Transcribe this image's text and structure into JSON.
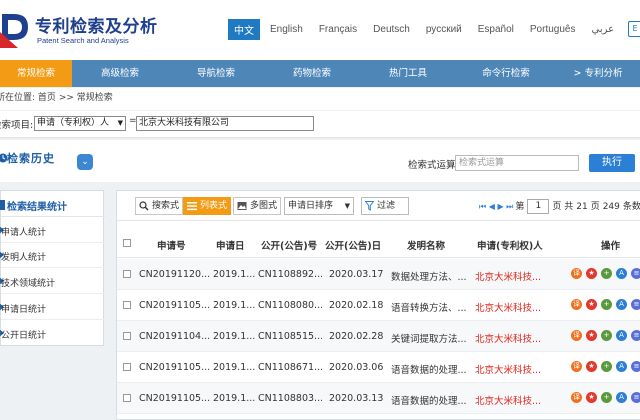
{
  "header": {
    "title": "专利检索及分析",
    "subtitle": "Patent Search and Analysis",
    "languages": [
      "中文",
      "English",
      "Français",
      "Deutsch",
      "русский",
      "Español",
      "Português",
      "عربي"
    ],
    "active_language": "中文",
    "help_glyph": "E"
  },
  "nav": {
    "items": [
      "常规检索",
      "高级检索",
      "导航检索",
      "药物检索",
      "热门工具",
      "命令行检索",
      "> 专利分析"
    ],
    "active": "常规检索"
  },
  "breadcrumb": {
    "prefix": "所在位置:",
    "home": "首页",
    "sep": ">>",
    "current": "常规检索"
  },
  "search": {
    "label": "检索项目:",
    "field": "申请（专利权）人",
    "eq": "=",
    "value": "北京大米科技有限公司"
  },
  "history": {
    "title": "检索历史",
    "op_label": "检索式运算",
    "op_placeholder": "检索式运算",
    "exec_label": "执行"
  },
  "stats": {
    "title": "检索结果统计",
    "items": [
      "申请人统计",
      "发明人统计",
      "技术领域统计",
      "申请日统计",
      "公开日统计"
    ]
  },
  "toolbar": {
    "search_view": "搜索式",
    "list_view": "列表式",
    "multi_view": "多图式",
    "sort": "申请日排序",
    "filter": "过滤",
    "pager": {
      "prefix_nav": "⏮ ◀ ▶ ⏭",
      "page_label_before": "第",
      "page": "1",
      "page_label_after": "页 共",
      "total_pages": "21",
      "pages_unit": "页",
      "total_items": "249",
      "items_unit": "条数"
    }
  },
  "table": {
    "headers": [
      "申请号",
      "申请日",
      "公开(公告)号",
      "公开(公告)日",
      "发明名称",
      "申请(专利权)人",
      "操作"
    ],
    "rows": [
      [
        "CN20191120...",
        "2019.1...",
        "CN1108892...",
        "2020.03.17",
        "数据处理方法、...",
        "北京大米科技..."
      ],
      [
        "CN20191105...",
        "2019.1...",
        "CN1108080...",
        "2020.02.18",
        "语音转换方法、...",
        "北京大米科技..."
      ],
      [
        "CN20191104...",
        "2019.1...",
        "CN1108515...",
        "2020.02.28",
        "关键词提取方法...",
        "北京大米科技..."
      ],
      [
        "CN20191105...",
        "2019.1...",
        "CN1108671...",
        "2020.03.06",
        "语音数据的处理...",
        "北京大米科技..."
      ],
      [
        "CN20191105...",
        "2019.1...",
        "CN1108803...",
        "2020.03.13",
        "语音数据的处理...",
        "北京大米科技..."
      ]
    ],
    "op_icons": [
      {
        "name": "translate-icon",
        "glyph": "译",
        "color": "#f0701e"
      },
      {
        "name": "favorite-icon",
        "glyph": "★",
        "color": "#e5372b"
      },
      {
        "name": "add-icon",
        "glyph": "+",
        "color": "#5a9a3c"
      },
      {
        "name": "analysis-icon",
        "glyph": "A",
        "color": "#2b7fd4"
      },
      {
        "name": "detail-icon",
        "glyph": "≡",
        "color": "#5a6fd6"
      }
    ]
  },
  "colors": {
    "brand": "#1f3f8f",
    "nav_bg": "#4f86b8",
    "accent": "#f39b14",
    "link_blue": "#2b7fd4",
    "applicant_red": "#e1261c"
  }
}
